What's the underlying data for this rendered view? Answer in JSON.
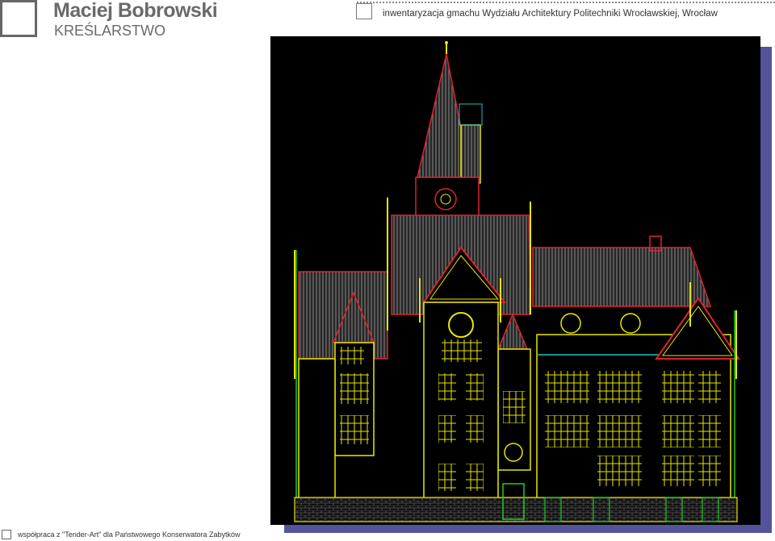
{
  "header": {
    "name": "Maciej Bobrowski",
    "subtitle": "KREŚLARSTWO",
    "project_title": "inwentaryzacja gmachu Wydziału Architektury Politechniki Wrocławskiej, Wrocław"
  },
  "footer": {
    "credit": "współpraca z \"Tender-Art\" dla Państwowego Konserwatora Zabytków"
  },
  "drawing": {
    "icon": "cad-elevation-drawing",
    "background": "#000000",
    "line_colors": [
      "#e8e800",
      "#e02030",
      "#20d020",
      "#20c0c0",
      "#c8c8c8",
      "#ffffff"
    ]
  },
  "colors": {
    "brand_gray": "#6a6a6a",
    "shadow": "#35368a"
  }
}
